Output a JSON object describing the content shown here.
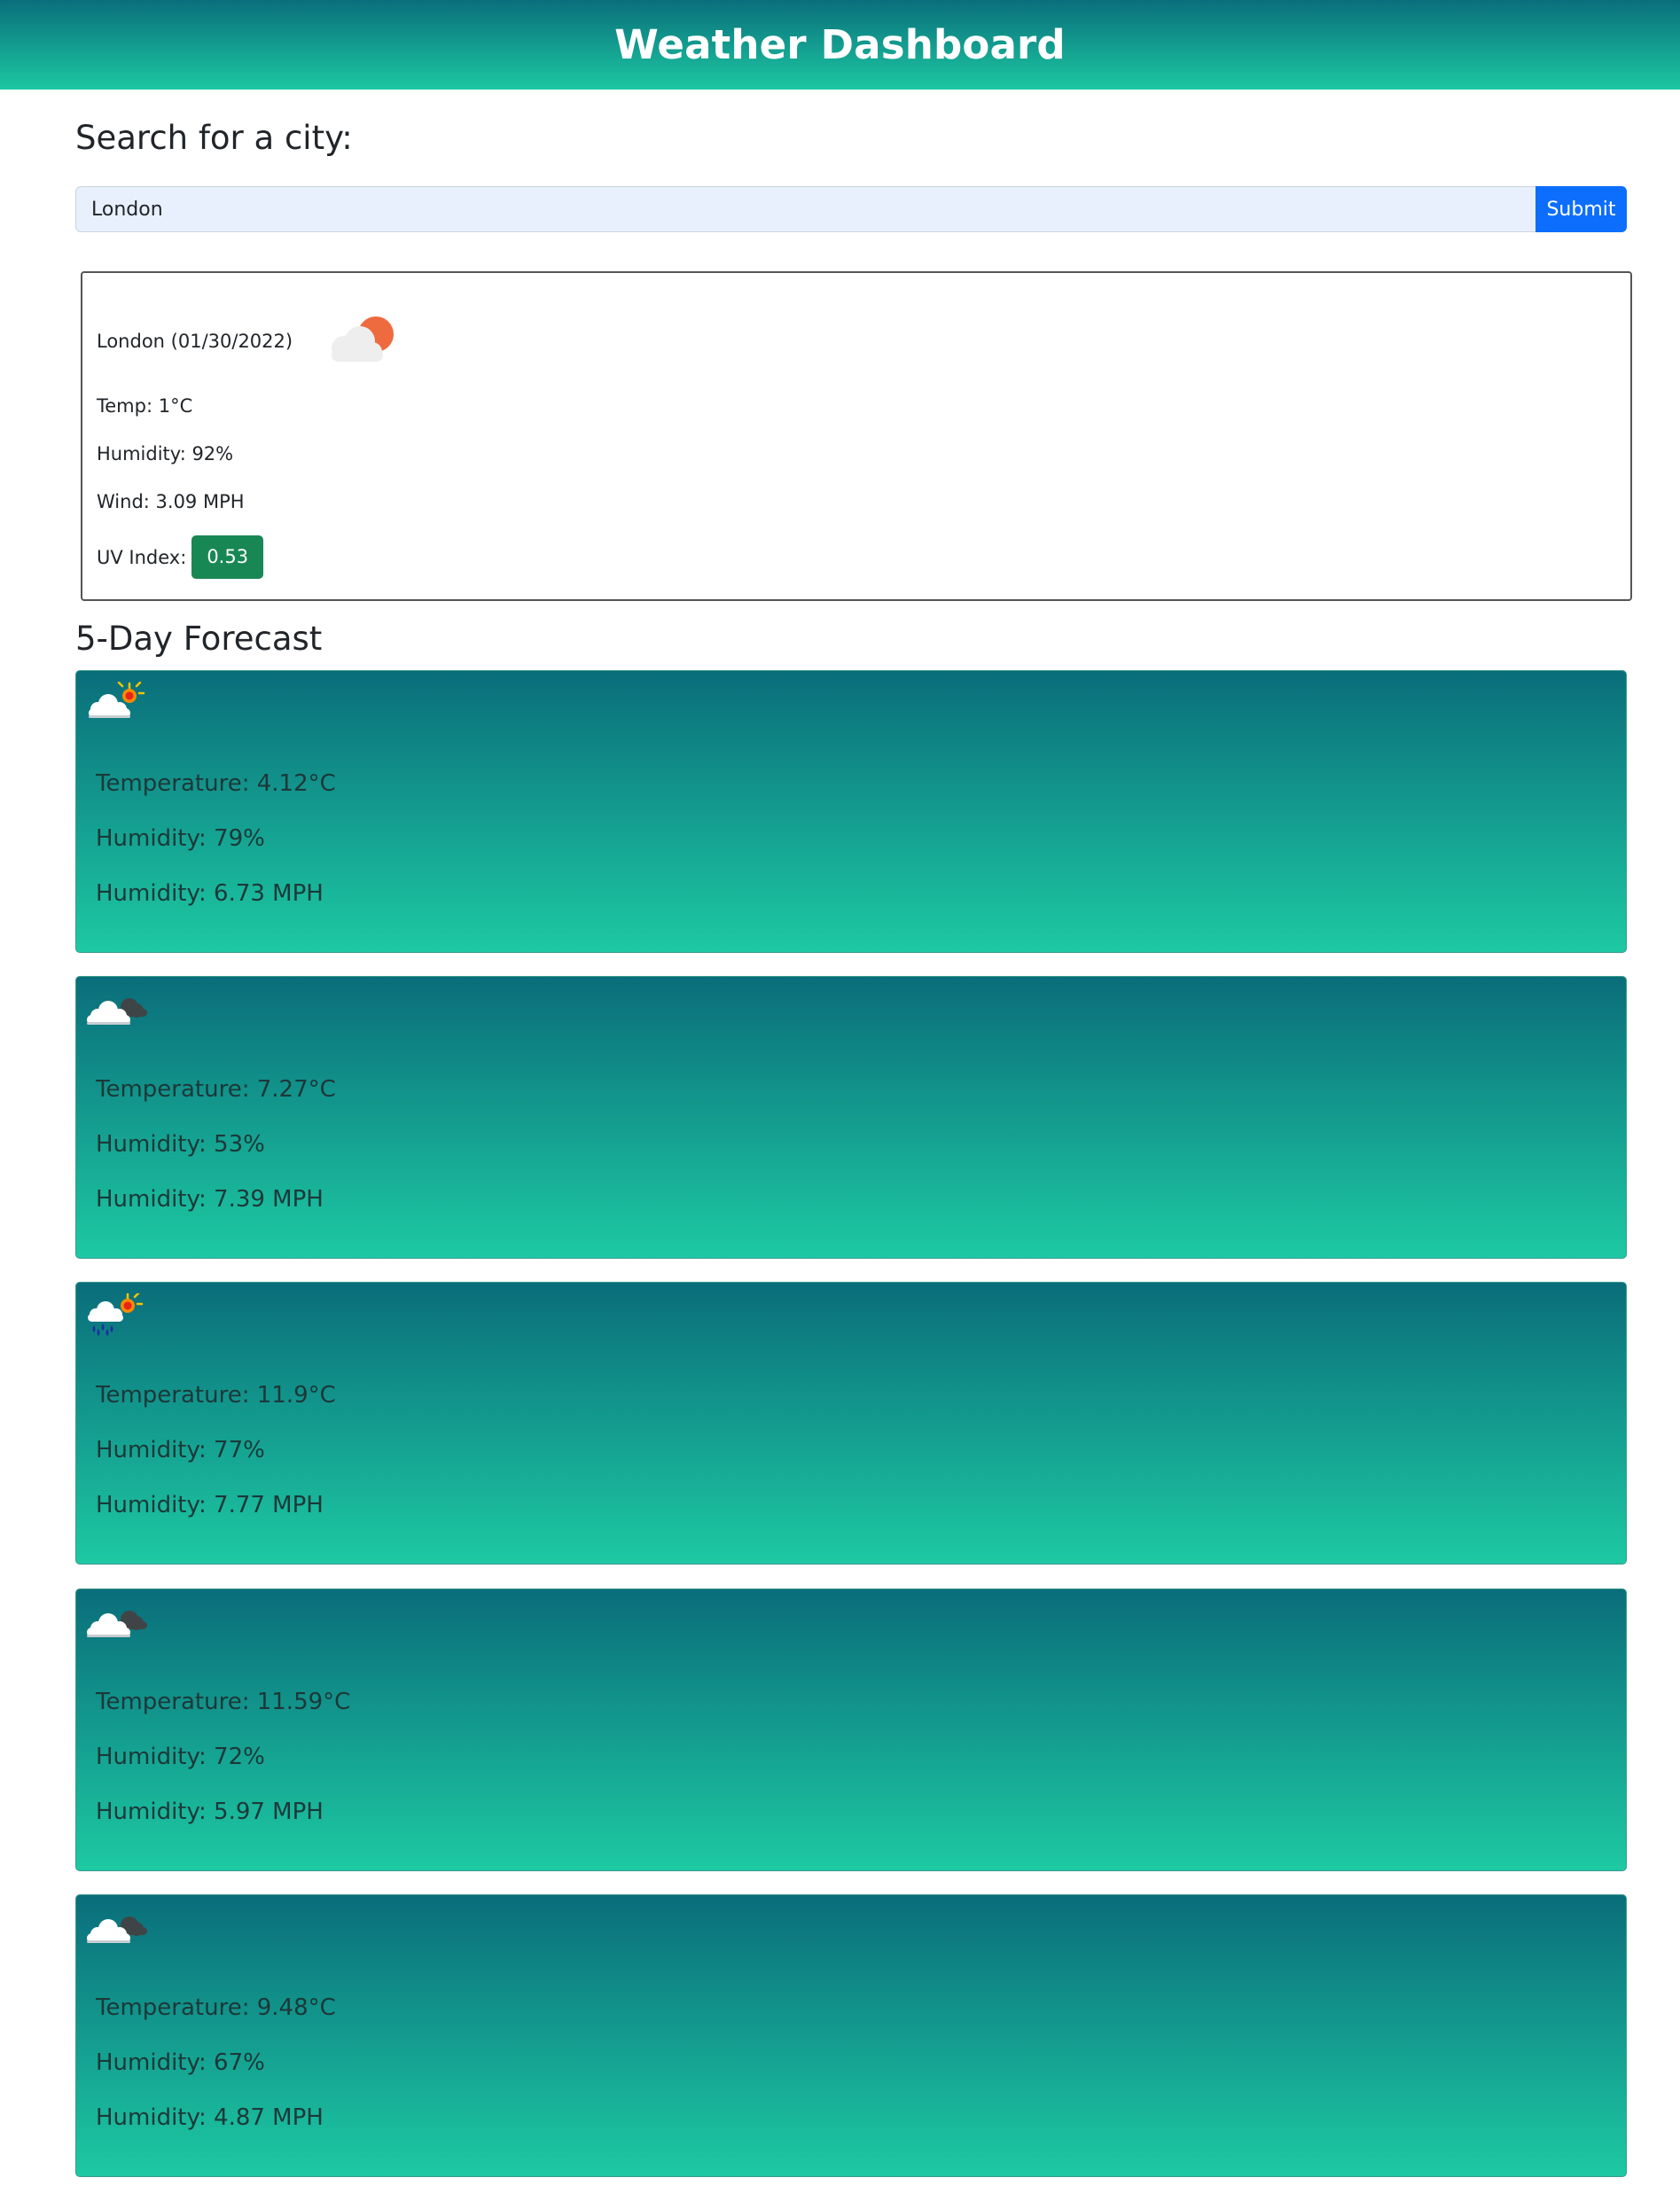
{
  "header": {
    "title": "Weather Dashboard"
  },
  "search": {
    "heading": "Search for a city:",
    "value": "London",
    "submit_label": "Submit"
  },
  "current": {
    "title": "London (01/30/2022)",
    "icon": "cloud-sun-icon",
    "temp": "Temp: 1°C",
    "humidity": "Humidity: 92%",
    "wind": "Wind: 3.09 MPH",
    "uv_label": "UV Index:",
    "uv_value": "0.53"
  },
  "forecast": {
    "heading": "5-Day Forecast",
    "days": [
      {
        "icon": "partly-sunny-icon",
        "temp": "Temperature: 4.12°C",
        "humidity": "Humidity: 79%",
        "wind": "Humidity: 6.73 MPH"
      },
      {
        "icon": "cloudy-icon",
        "temp": "Temperature: 7.27°C",
        "humidity": "Humidity: 53%",
        "wind": "Humidity: 7.39 MPH"
      },
      {
        "icon": "rain-sun-icon",
        "temp": "Temperature: 11.9°C",
        "humidity": "Humidity: 77%",
        "wind": "Humidity: 7.77 MPH"
      },
      {
        "icon": "cloudy-icon",
        "temp": "Temperature: 11.59°C",
        "humidity": "Humidity: 72%",
        "wind": "Humidity: 5.97 MPH"
      },
      {
        "icon": "cloudy-icon",
        "temp": "Temperature: 9.48°C",
        "humidity": "Humidity: 67%",
        "wind": "Humidity: 4.87 MPH"
      }
    ]
  },
  "colors": {
    "header_gradient": [
      "#0a6f7b",
      "#1cc7a2"
    ],
    "submit_button": "#0d6efd",
    "uv_badge": "#198754",
    "card_gradient": [
      "#0a6d7a",
      "#1dc9a3"
    ]
  }
}
